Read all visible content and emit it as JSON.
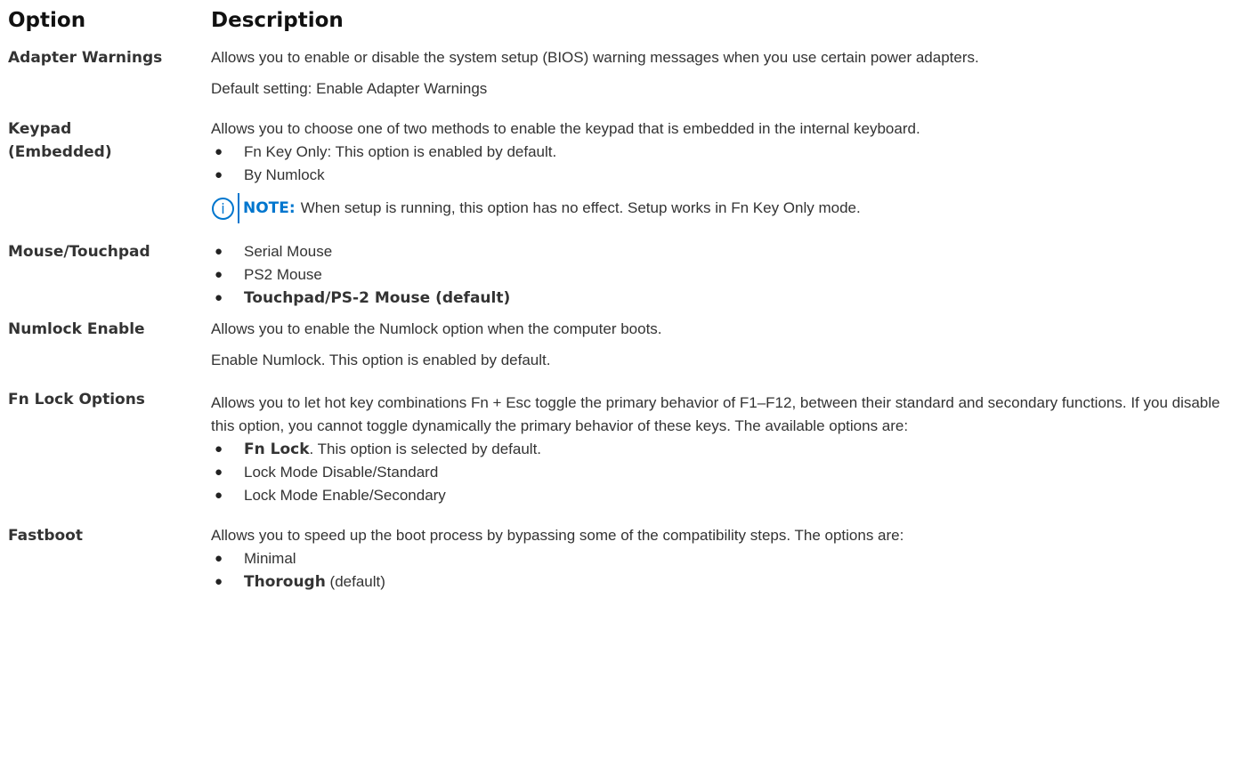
{
  "header": {
    "option": "Option",
    "description": "Description"
  },
  "rows": {
    "adapter": {
      "option": "Adapter Warnings",
      "text": "Allows you to enable or disable the system setup (BIOS) warning messages when you use certain power adapters.",
      "default": "Default setting: Enable Adapter Warnings"
    },
    "keypad": {
      "option_line1": "Keypad",
      "option_line2": "(Embedded)",
      "text": "Allows you to choose one of two methods to enable the keypad that is embedded in the internal keyboard.",
      "items": [
        "Fn Key Only: This option is enabled by default.",
        "By Numlock"
      ],
      "note_label": "NOTE:",
      "note_text": "When setup is running, this option has no effect. Setup works in Fn Key Only mode."
    },
    "mouse": {
      "option": "Mouse/Touchpad",
      "items": [
        "Serial Mouse",
        "PS2 Mouse",
        "Touchpad/PS-2 Mouse (default)"
      ]
    },
    "numlock": {
      "option": "Numlock Enable",
      "text": "Allows you to enable the Numlock option when the computer boots.",
      "default": "Enable Numlock. This option is enabled by default."
    },
    "fnlock": {
      "option": "Fn Lock Options",
      "text": "Allows you to let hot key combinations Fn + Esc toggle the primary behavior of F1–F12, between their standard and secondary functions. If you disable this option, you cannot toggle dynamically the primary behavior of these keys. The available options are:",
      "item1_bold": "Fn Lock",
      "item1_rest": ". This option is selected by default.",
      "item2": "Lock Mode Disable/Standard",
      "item3": "Lock Mode Enable/Secondary"
    },
    "fastboot": {
      "option": "Fastboot",
      "text": "Allows you to speed up the boot process by bypassing some of the compatibility steps. The options are:",
      "item1": "Minimal",
      "item2_bold": "Thorough",
      "item2_rest": " (default)"
    }
  },
  "icons": {
    "bullet": "bullet-icon",
    "note": "info-icon"
  },
  "colors": {
    "note_accent": "#0076ce",
    "text": "#333333"
  }
}
